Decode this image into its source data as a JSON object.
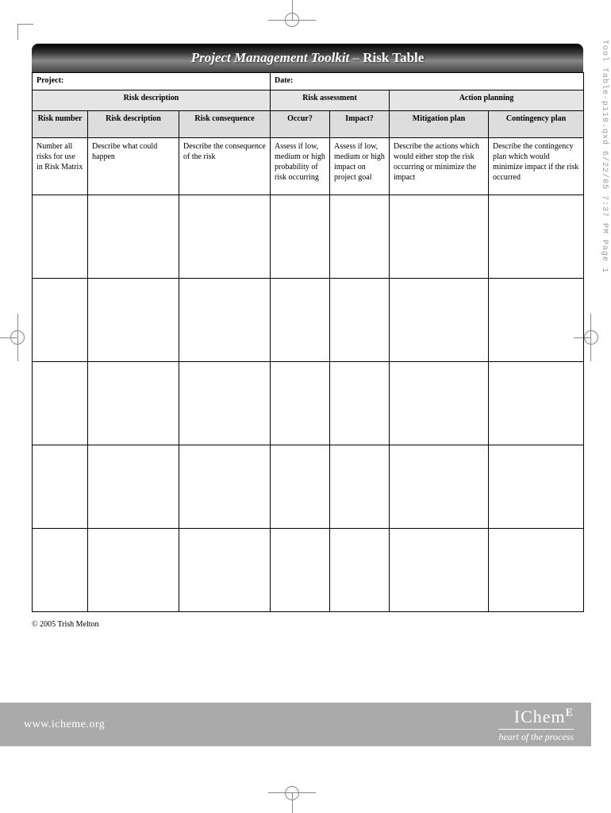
{
  "sideText": "Tool Table-p110.qxd  6/22/05  7:37 PM  Page 1",
  "title": {
    "part1": "Project Management Toolkit",
    "sep": " – ",
    "part2": "Risk Table"
  },
  "meta": {
    "projectLabel": "Project:",
    "dateLabel": "Date:"
  },
  "groups": {
    "desc": "Risk description",
    "assess": "Risk assessment",
    "action": "Action planning"
  },
  "subheaders": {
    "num": "Risk number",
    "desc": "Risk description",
    "cons": "Risk consequence",
    "occur": "Occur?",
    "impact": "Impact?",
    "mit": "Mitigation plan",
    "cont": "Contingency plan"
  },
  "hints": {
    "num": "Number all risks for use in Risk Matrix",
    "desc": "Describe what could happen",
    "cons": "Describe the consequence of the risk",
    "occur": "Assess if low, medium or high probability of risk occurring",
    "impact": "Assess if low, medium or high impact on project goal",
    "mit": "Describe the actions which would either stop the risk occurring or minimize the impact",
    "cont": "Describe the contingency plan which would minimize impact if the risk occurred"
  },
  "copyright": "© 2005 Trish Melton",
  "footer": {
    "url": "www.icheme.org",
    "brand": "IChem",
    "brandE": "E",
    "tagline": "heart of the process"
  }
}
